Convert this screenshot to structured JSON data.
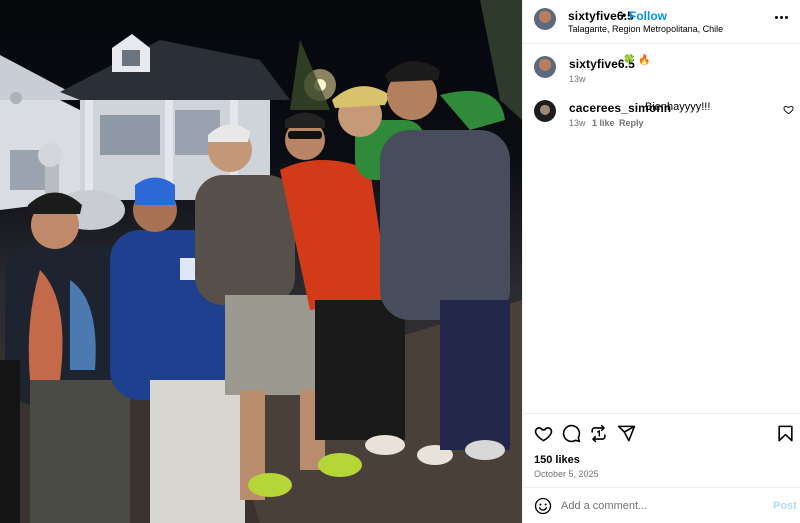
{
  "post": {
    "username": "sixtyfive6.5",
    "follow_label": "Follow",
    "separator": "•",
    "location": "Talagante, Region Metropolitana, Chile",
    "caption_emojis": "🍀 🔥",
    "caption_time": "13w",
    "likes": "150 likes",
    "date": "October 5, 2025"
  },
  "comments": [
    {
      "username": "cacerees_simonn",
      "text": "Bienhayyyy!!!",
      "time": "13w",
      "likes": "1 like",
      "reply_label": "Reply"
    }
  ],
  "composer": {
    "placeholder": "Add a comment...",
    "post_label": "Post"
  },
  "icons": {
    "more": "more-options-icon",
    "like": "heart-icon",
    "comment": "comment-icon",
    "repost": "repost-icon",
    "share": "share-icon",
    "save": "bookmark-icon",
    "emoji": "emoji-icon"
  },
  "colors": {
    "accent": "#0095f6",
    "muted": "#737373",
    "post_disabled": "#b3dbff"
  }
}
